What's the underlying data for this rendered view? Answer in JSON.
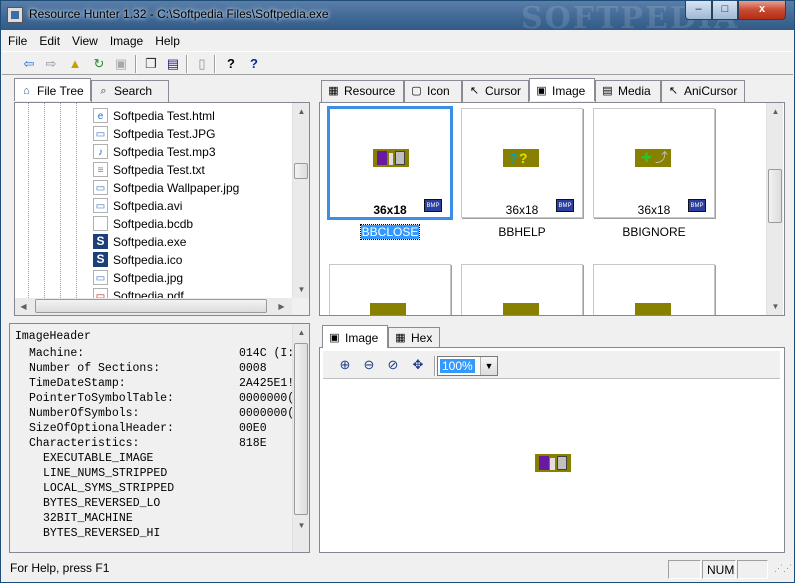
{
  "window": {
    "title": "Resource Hunter 1.32 - C:\\Softpedia Files\\Softpedia.exe",
    "watermark": "SOFTPEDIA",
    "buttons": {
      "minimize": "–",
      "maximize": "□",
      "close": "x"
    }
  },
  "menu": [
    "File",
    "Edit",
    "View",
    "Image",
    "Help"
  ],
  "toolbar": [
    {
      "icon": "back-arrow-icon",
      "glyph": "⇦",
      "color": "#1e6fd0"
    },
    {
      "icon": "forward-arrow-icon",
      "glyph": "⇨",
      "color": "#909090"
    },
    {
      "icon": "up-folder-icon",
      "glyph": "▲",
      "color": "#c9a000"
    },
    {
      "icon": "refresh-icon",
      "glyph": "↻",
      "color": "#2b8a2b"
    },
    {
      "icon": "save-disabled-icon",
      "glyph": "▣",
      "color": "#a8a8a8"
    },
    {
      "icon": "copy-icon",
      "glyph": "❐",
      "color": "#303030"
    },
    {
      "icon": "save-icon",
      "glyph": "▤",
      "color": "#202080"
    },
    {
      "icon": "delete-icon",
      "glyph": "▯",
      "color": "#909090"
    },
    {
      "icon": "help-icon",
      "glyph": "?",
      "color": "#000000"
    },
    {
      "icon": "context-help-icon",
      "glyph": "?",
      "color": "#0a2a8a"
    }
  ],
  "left_tabs": [
    {
      "label": "File Tree",
      "active": true,
      "icon": "file-tree-icon"
    },
    {
      "label": "Search",
      "active": false,
      "icon": "search-icon"
    }
  ],
  "file_tree": [
    {
      "name": "Softpedia Test.html",
      "icon": "html-file-icon",
      "glyph": "e",
      "color": "#1a6fd0"
    },
    {
      "name": "Softpedia Test.JPG",
      "icon": "image-file-icon",
      "glyph": "▭",
      "color": "#2d6fb8"
    },
    {
      "name": "Softpedia Test.mp3",
      "icon": "audio-file-icon",
      "glyph": "♪",
      "color": "#2060c0"
    },
    {
      "name": "Softpedia Test.txt",
      "icon": "text-file-icon",
      "glyph": "≡",
      "color": "#808080"
    },
    {
      "name": "Softpedia Wallpaper.jpg",
      "icon": "image-file-icon",
      "glyph": "▭",
      "color": "#2d6fb8"
    },
    {
      "name": "Softpedia.avi",
      "icon": "video-file-icon",
      "glyph": "▭",
      "color": "#2d6fb8"
    },
    {
      "name": "Softpedia.bcdb",
      "icon": "generic-file-icon",
      "glyph": "",
      "color": "#808080"
    },
    {
      "name": "Softpedia.exe",
      "icon": "softpedia-exe-icon",
      "glyph": "S",
      "color": "#1c3f7a"
    },
    {
      "name": "Softpedia.ico",
      "icon": "softpedia-ico-icon",
      "glyph": "S",
      "color": "#1c3f7a"
    },
    {
      "name": "Softpedia.jpg",
      "icon": "image-file-icon",
      "glyph": "▭",
      "color": "#2d6fb8"
    },
    {
      "name": "Softpedia.pdf",
      "icon": "pdf-file-icon",
      "glyph": "▭",
      "color": "#c02020"
    }
  ],
  "header_info": {
    "title": "ImageHeader",
    "rows": [
      {
        "key": "Machine:",
        "value": "014C (I:"
      },
      {
        "key": "Number of Sections:",
        "value": "0008"
      },
      {
        "key": "TimeDateStamp:",
        "value": "2A425E1!"
      },
      {
        "key": "PointerToSymbolTable:",
        "value": "0000000("
      },
      {
        "key": "NumberOfSymbols:",
        "value": "0000000("
      },
      {
        "key": "SizeOfOptionalHeader:",
        "value": "00E0"
      },
      {
        "key": "Characteristics:",
        "value": "818E"
      }
    ],
    "flags": [
      "EXECUTABLE_IMAGE",
      "LINE_NUMS_STRIPPED",
      "LOCAL_SYMS_STRIPPED",
      "BYTES_REVERSED_LO",
      "32BIT_MACHINE",
      "BYTES_REVERSED_HI"
    ]
  },
  "resource_tabs": [
    {
      "label": "Resource",
      "active": false,
      "icon": "resource-icon"
    },
    {
      "label": "Icon",
      "active": false,
      "icon": "icon-type-icon"
    },
    {
      "label": "Cursor",
      "active": false,
      "icon": "cursor-icon"
    },
    {
      "label": "Image",
      "active": true,
      "icon": "image-type-icon"
    },
    {
      "label": "Media",
      "active": false,
      "icon": "media-icon"
    },
    {
      "label": "AniCursor",
      "active": false,
      "icon": "anicursor-icon"
    }
  ],
  "thumbnails": [
    {
      "name": "BBCLOSE",
      "dims": "36x18",
      "selected": true,
      "badge": "BMP",
      "art": "close"
    },
    {
      "name": "BBHELP",
      "dims": "36x18",
      "selected": false,
      "badge": "BMP",
      "art": "help"
    },
    {
      "name": "BBIGNORE",
      "dims": "36x18",
      "selected": false,
      "badge": "BMP",
      "art": "ignore"
    }
  ],
  "preview_tabs": [
    {
      "label": "Image",
      "active": true,
      "icon": "image-preview-icon"
    },
    {
      "label": "Hex",
      "active": false,
      "icon": "hex-icon"
    }
  ],
  "zoom": {
    "value": "100%",
    "buttons": [
      "zoom-in-icon",
      "zoom-out-icon",
      "zoom-reset-icon",
      "fit-icon"
    ]
  },
  "status": {
    "text": "For Help, press F1",
    "num": "NUM"
  }
}
